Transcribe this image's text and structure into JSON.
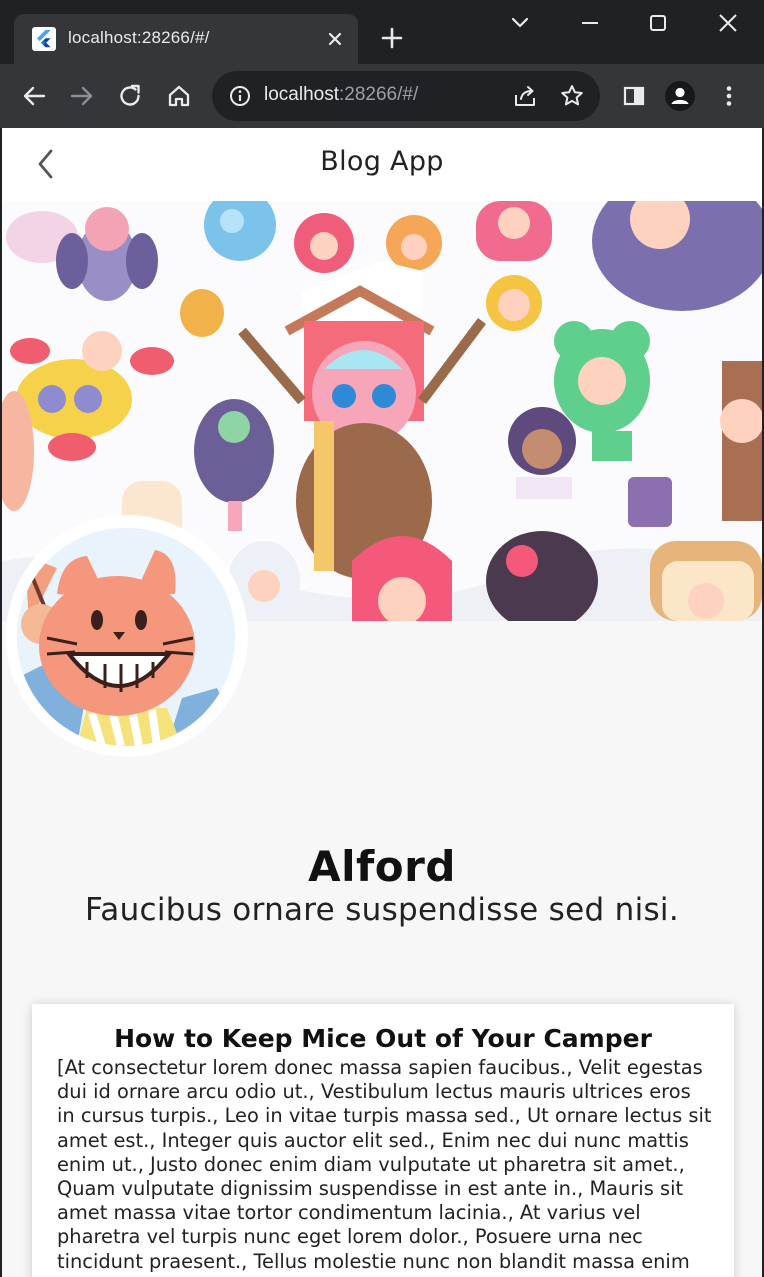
{
  "browser": {
    "tab_title": "localhost:28266/#/",
    "url_host": "localhost",
    "url_rest": ":28266/#/"
  },
  "app": {
    "title": "Blog App"
  },
  "profile": {
    "name": "Alford",
    "bio": "Faucibus ornare suspendisse sed nisi."
  },
  "post": {
    "title": "How to Keep Mice Out of Your Camper",
    "body": "[At consectetur lorem donec massa sapien faucibus., Velit egestas dui id ornare arcu odio ut., Vestibulum lectus mauris ultrices eros in cursus turpis., Leo in vitae turpis massa sed., Ut ornare lectus sit amet est., Integer quis auctor elit sed., Enim nec dui nunc mattis enim ut., Justo donec enim diam vulputate ut pharetra sit amet., Quam vulputate dignissim suspendisse in est ante in., Mauris sit amet massa vitae tortor condimentum lacinia., At varius vel pharetra vel turpis nunc eget lorem dolor., Posuere urna nec tincidunt praesent., Tellus molestie nunc non blandit massa enim nec dui nunc."
  },
  "icons": {
    "back": "chevron-left-icon",
    "reload": "reload-icon",
    "home": "home-icon",
    "info": "info-icon",
    "share": "share-icon",
    "star": "star-icon",
    "sidepanel": "side-panel-icon",
    "profile": "profile-icon",
    "menu": "kebab-menu-icon"
  },
  "colors": {
    "chrome_dark": "#202124",
    "chrome_toolbar": "#35363a",
    "page_bg": "#f7f7f7",
    "card_bg": "#ffffff"
  }
}
